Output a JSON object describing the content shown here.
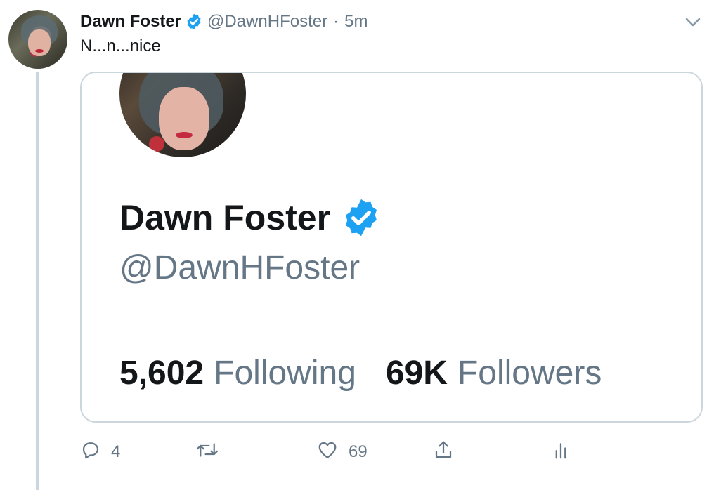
{
  "tweet": {
    "author_name": "Dawn Foster",
    "author_handle": "@DawnHFoster",
    "separator": "·",
    "time": "5m",
    "text": "N...n...nice",
    "verified_icon": "verified-badge-icon",
    "menu_icon": "chevron-down-icon"
  },
  "card": {
    "name": "Dawn Foster",
    "handle": "@DawnHFoster",
    "following_count": "5,602",
    "following_label": "Following",
    "followers_count": "69K",
    "followers_label": "Followers"
  },
  "actions": {
    "reply_count": "4",
    "retweet_count": "",
    "like_count": "69",
    "icons": [
      "reply-icon",
      "retweet-icon",
      "like-icon",
      "share-icon",
      "analytics-icon"
    ]
  },
  "colors": {
    "verified": "#1da1f2",
    "secondary_text": "#657786",
    "border": "#ccd6dd"
  }
}
